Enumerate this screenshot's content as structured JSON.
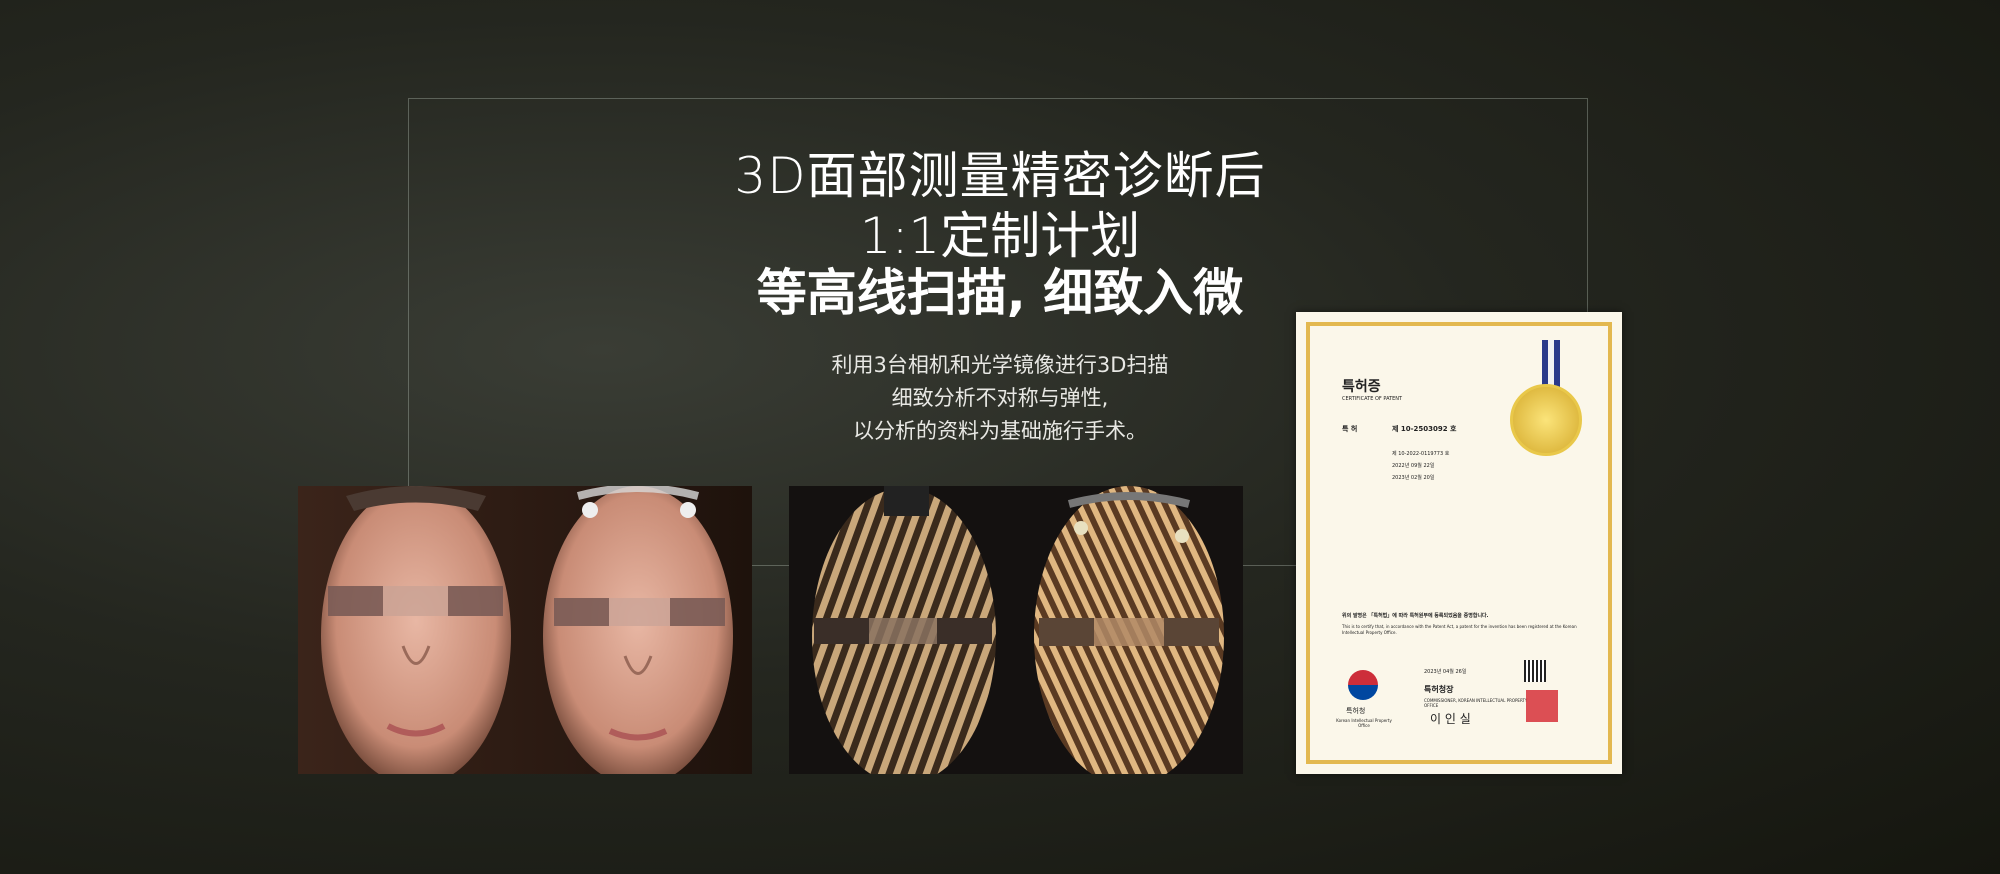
{
  "headline": {
    "line1": "3D面部测量精密诊断后",
    "line2": "1:1定制计划",
    "line3": "等高线扫描, 细致入微"
  },
  "description": {
    "line1": "利用3台相机和光学镜像进行3D扫描",
    "line2": "细致分析不对称与弹性,",
    "line3": "以分析的资料为基础施行手术。"
  },
  "certificate": {
    "title_ko": "특허증",
    "title_en": "CERTIFICATE OF PATENT",
    "patent_label": "특 허",
    "patent_no": "제 10-2503092 호",
    "application_no": "제 10-2022-0119773 호",
    "filing_date": "2022년 09월 22일",
    "registration_date": "2023년 02월 20일",
    "statement_ko": "위의 발명은 「특허법」에 따라 특허원부에 등록되었음을 증명합니다.",
    "statement_en": "This is to certify that, in accordance with the Patent Act, a patent for the invention has been registered at the Korean Intellectual Property Office.",
    "issue_date": "2023년 04월 26일",
    "commissioner_ko": "특허청장",
    "commissioner_en": "COMMISSIONER, KOREAN INTELLECTUAL PROPERTY OFFICE",
    "office_ko": "특허청",
    "office_en": "Korean Intellectual Property Office",
    "signature": "이 인 실"
  }
}
